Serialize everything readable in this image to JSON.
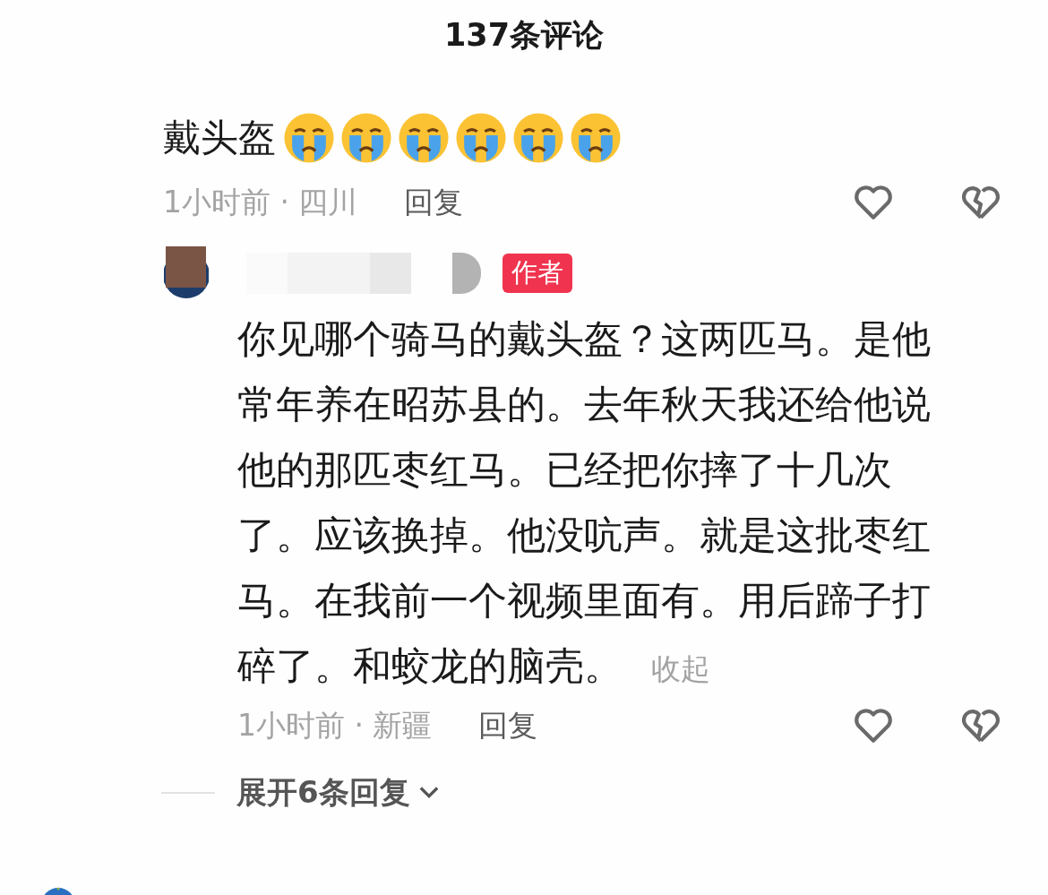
{
  "header": {
    "title": "137条评论"
  },
  "comment": {
    "text": "戴头盔",
    "emojis": [
      {
        "kind": "crying"
      },
      {
        "kind": "crying"
      },
      {
        "kind": "crying"
      },
      {
        "kind": "crying"
      },
      {
        "kind": "crying"
      },
      {
        "kind": "crying"
      }
    ],
    "time": "1小时前 · 四川",
    "reply_label": "回复"
  },
  "reply": {
    "badge": "作者",
    "text": "你见哪个骑马的戴头盔？这两匹马。是他常年养在昭苏县的。去年秋天我还给他说他的那匹枣红马。已经把你摔了十几次了。应该换掉。他没吭声。就是这批枣红马。在我前一个视频里面有。用后蹄子打碎了。和蛟龙的脑壳。",
    "collapse": "收起",
    "time": "1小时前 · 新疆",
    "reply_label": "回复"
  },
  "expand": {
    "label": "展开6条回复"
  }
}
